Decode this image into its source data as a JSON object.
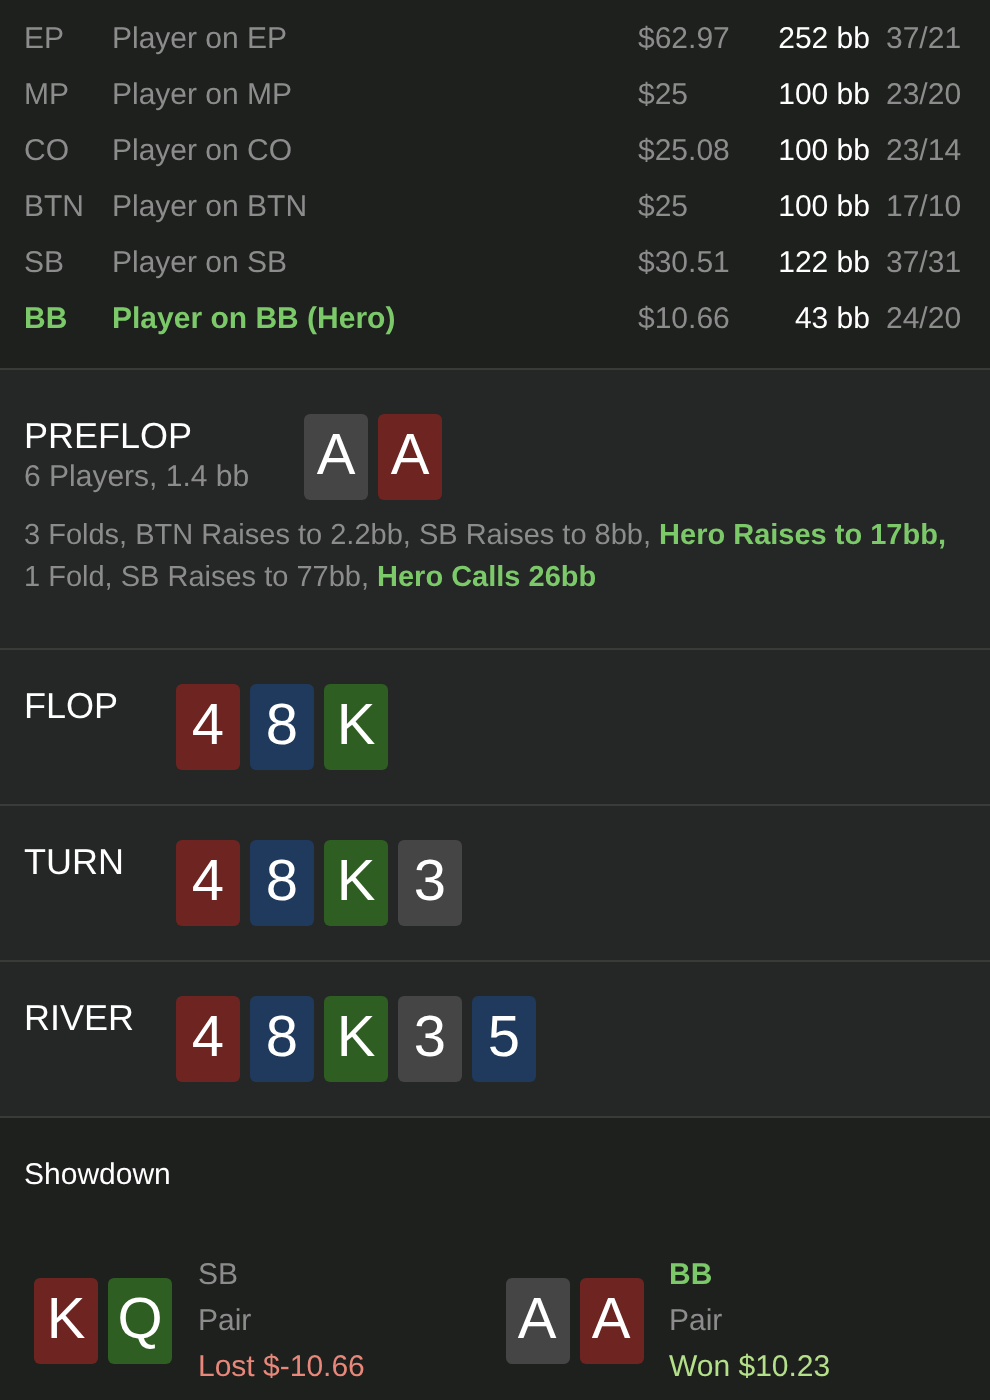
{
  "players": [
    {
      "position": "EP",
      "name": "Player on EP",
      "stack": "$62.97",
      "bb": "252 bb",
      "stats": "37/21",
      "hero": false
    },
    {
      "position": "MP",
      "name": "Player on MP",
      "stack": "$25",
      "bb": "100 bb",
      "stats": "23/20",
      "hero": false
    },
    {
      "position": "CO",
      "name": "Player on CO",
      "stack": "$25.08",
      "bb": "100 bb",
      "stats": "23/14",
      "hero": false
    },
    {
      "position": "BTN",
      "name": "Player on BTN",
      "stack": "$25",
      "bb": "100 bb",
      "stats": "17/10",
      "hero": false
    },
    {
      "position": "SB",
      "name": "Player on SB",
      "stack": "$30.51",
      "bb": "122 bb",
      "stats": "37/31",
      "hero": false
    },
    {
      "position": "BB",
      "name": "Player on BB (Hero)",
      "stack": "$10.66",
      "bb": "43 bb",
      "stats": "24/20",
      "hero": true
    }
  ],
  "preflop": {
    "title": "PREFLOP",
    "subtitle": "6 Players, 1.4 bb",
    "cards": [
      {
        "rank": "A",
        "color": "#454545"
      },
      {
        "rank": "A",
        "color": "#6e2420"
      }
    ],
    "actions": "3 Folds, BTN Raises to 2.2bb, SB Raises to 8bb, **Hero Raises to 17bb,** 1 Fold, SB Raises to 77bb, **Hero Calls 26bb**"
  },
  "streets": [
    {
      "title": "FLOP",
      "cards": [
        {
          "rank": "4",
          "color": "#6e2420"
        },
        {
          "rank": "8",
          "color": "#1f3a5c"
        },
        {
          "rank": "K",
          "color": "#2e5e22"
        }
      ]
    },
    {
      "title": "TURN",
      "cards": [
        {
          "rank": "4",
          "color": "#6e2420"
        },
        {
          "rank": "8",
          "color": "#1f3a5c"
        },
        {
          "rank": "K",
          "color": "#2e5e22"
        },
        {
          "rank": "3",
          "color": "#454545"
        }
      ]
    },
    {
      "title": "RIVER",
      "cards": [
        {
          "rank": "4",
          "color": "#6e2420"
        },
        {
          "rank": "8",
          "color": "#1f3a5c"
        },
        {
          "rank": "K",
          "color": "#2e5e22"
        },
        {
          "rank": "3",
          "color": "#454545"
        },
        {
          "rank": "5",
          "color": "#1f3a5c"
        }
      ]
    }
  ],
  "showdown": {
    "title": "Showdown",
    "hands": [
      {
        "cards": [
          {
            "rank": "K",
            "color": "#6e2420"
          },
          {
            "rank": "Q",
            "color": "#2e5e22"
          }
        ],
        "position": "SB",
        "hero": false,
        "hand": "Pair",
        "result": "Lost $-10.66",
        "kind": "lost"
      },
      {
        "cards": [
          {
            "rank": "A",
            "color": "#454545"
          },
          {
            "rank": "A",
            "color": "#6e2420"
          }
        ],
        "position": "BB",
        "hero": true,
        "hand": "Pair",
        "result": "Won $10.23",
        "kind": "won"
      }
    ]
  }
}
